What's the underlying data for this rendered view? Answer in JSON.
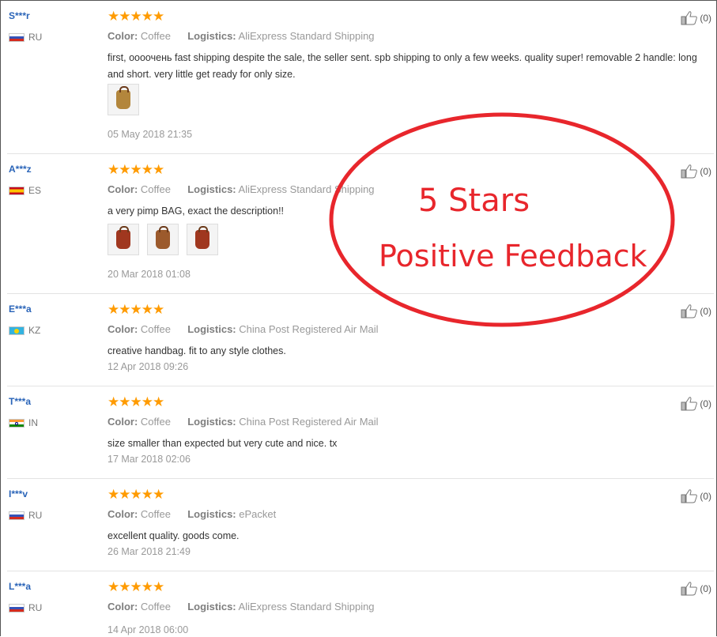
{
  "labels": {
    "color": "Color:",
    "logistics": "Logistics:"
  },
  "reviews": [
    {
      "user": "S***r",
      "country": "RU",
      "rating": 5,
      "stars": "★★★★★",
      "color": "Coffee",
      "logistics": "AliExpress Standard Shipping",
      "text": "first, оооочень fast shipping despite the sale, the seller sent. spb shipping to only a few weeks. quality super! removable 2 handle: long and short. very little get ready for only size.",
      "date": "05 May 2018 21:35",
      "helpful": "(0)"
    },
    {
      "user": "A***z",
      "country": "ES",
      "rating": 5,
      "stars": "★★★★★",
      "color": "Coffee",
      "logistics": "AliExpress Standard Shipping",
      "text": "a very pimp BAG, exact the description!!",
      "date": "20 Mar 2018 01:08",
      "helpful": "(0)"
    },
    {
      "user": "E***a",
      "country": "KZ",
      "rating": 5,
      "stars": "★★★★★",
      "color": "Coffee",
      "logistics": "China Post Registered Air Mail",
      "text": "creative handbag. fit to any style clothes.",
      "date": "12 Apr 2018 09:26",
      "helpful": "(0)"
    },
    {
      "user": "T***a",
      "country": "IN",
      "rating": 5,
      "stars": "★★★★★",
      "color": "Coffee",
      "logistics": "China Post Registered Air Mail",
      "text": "size smaller than expected but very cute and nice. tx",
      "date": "17 Mar 2018 02:06",
      "helpful": "(0)"
    },
    {
      "user": "I***v",
      "country": "RU",
      "rating": 5,
      "stars": "★★★★★",
      "color": "Coffee",
      "logistics": "ePacket",
      "text": "excellent quality. goods come.",
      "date": "26 Mar 2018 21:49",
      "helpful": "(0)"
    },
    {
      "user": "L***a",
      "country": "RU",
      "rating": 5,
      "stars": "★★★★★",
      "color": "Coffee",
      "logistics": "AliExpress Standard Shipping",
      "text": "",
      "date": "14 Apr 2018 06:00",
      "helpful": "(0)"
    }
  ],
  "overlay": {
    "line1": "5 Stars",
    "line2": "Positive Feedback",
    "color": "#e8262c"
  },
  "colors": {
    "user": "#2a64b8",
    "star": "#ff9b00",
    "muted": "#999999"
  }
}
